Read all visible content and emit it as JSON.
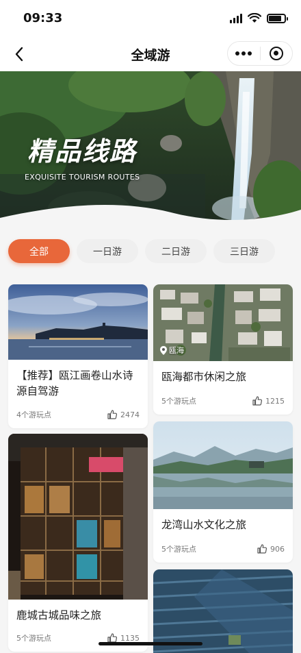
{
  "status_bar": {
    "time": "09:33",
    "battery_level": 0.8
  },
  "nav": {
    "title": "全域游"
  },
  "banner": {
    "title": "精品线路",
    "subtitle": "EXQUISITE TOURISM ROUTES"
  },
  "tabs": [
    {
      "label": "全部",
      "active": true
    },
    {
      "label": "一日游",
      "active": false
    },
    {
      "label": "二日游",
      "active": false
    },
    {
      "label": "三日游",
      "active": false
    }
  ],
  "cards": [
    {
      "title": "【推荐】瓯江画卷山水诗源自驾游",
      "spots": "4个游玩点",
      "likes": "2474",
      "image": "river-night-scene"
    },
    {
      "title": "瓯海都市休闲之旅",
      "spots": "5个游玩点",
      "likes": "1215",
      "location": "瓯海",
      "image": "aerial-town"
    },
    {
      "title": "鹿城古城品味之旅",
      "spots": "5个游玩点",
      "likes": "1135",
      "image": "lit-glass-building"
    },
    {
      "title": "龙湾山水文化之旅",
      "spots": "5个游玩点",
      "likes": "906",
      "image": "lake-mountains"
    },
    {
      "title": "",
      "spots": "",
      "likes": "",
      "image": "blue-tiled-roofs"
    }
  ],
  "colors": {
    "accent": "#e8673a",
    "tab_inactive": "#efefef",
    "background": "#f5f5f5"
  },
  "icons": [
    "back-arrow-icon",
    "more-dots-icon",
    "target-icon",
    "thumbs-up-icon",
    "location-pin-icon",
    "signal-icon",
    "wifi-icon",
    "battery-icon"
  ]
}
